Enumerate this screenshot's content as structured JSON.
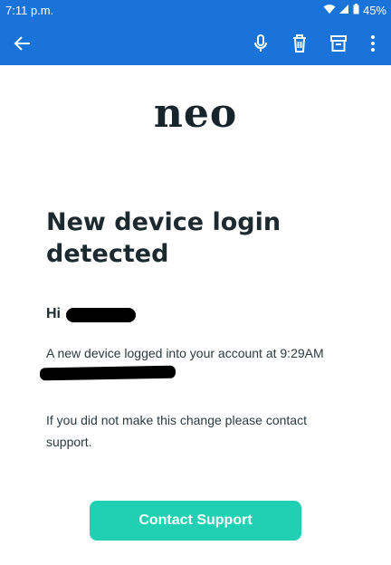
{
  "status_bar": {
    "time": "7:11 p.m.",
    "battery": "45%"
  },
  "app_bar": {
    "back_icon": "arrow-left-icon",
    "mic_icon": "microphone-icon",
    "delete_icon": "trash-icon",
    "archive_icon": "archive-icon",
    "more_icon": "more-vert-icon"
  },
  "email": {
    "logo": "neo",
    "title": "New device login detected",
    "greeting": "Hi",
    "message": "A new device logged into your account at 9:29AM",
    "support_text": "If you did not make this change please contact support.",
    "cta_label": "Contact Support"
  },
  "colors": {
    "header": "#1a73d9",
    "cta": "#1fd1b2",
    "text": "#1c2a30"
  }
}
